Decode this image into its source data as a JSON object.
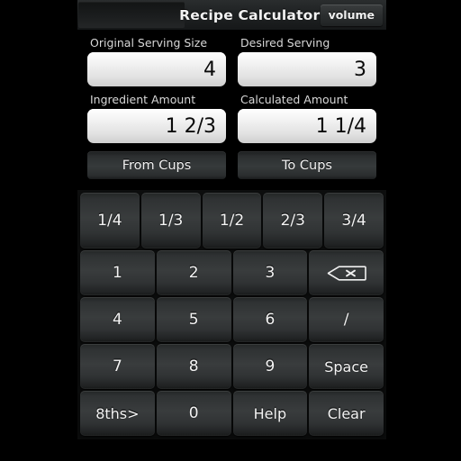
{
  "titlebar": {
    "title": "Recipe Calculator",
    "volume_label": "volume",
    "left_button_label": ""
  },
  "form": {
    "rows": [
      {
        "left": {
          "label": "Original Serving Size",
          "value": "4",
          "placeholder": ""
        },
        "right": {
          "label": "Desired Serving",
          "value": "3",
          "placeholder": ""
        }
      },
      {
        "left": {
          "label": "Ingredient Amount",
          "value": "1 2/3",
          "placeholder": ""
        },
        "right": {
          "label": "Calculated Amount",
          "value": "1 1/4",
          "placeholder": ""
        }
      }
    ],
    "from_cups_label": "From Cups",
    "to_cups_label": "To Cups"
  },
  "keypad": {
    "fraction_row": [
      "1/4",
      "1/3",
      "1/2",
      "2/3",
      "3/4"
    ],
    "rows": [
      [
        "1",
        "2",
        "3",
        "backspace-icon"
      ],
      [
        "4",
        "5",
        "6",
        "/"
      ],
      [
        "7",
        "8",
        "9",
        "Space"
      ],
      [
        "8ths>",
        "0",
        "Help",
        "Clear"
      ]
    ]
  },
  "colors": {
    "background": "#000000",
    "titlebar": "#202324",
    "key_face": "#393c3d",
    "input_face": "#f4f4f4",
    "text_light": "#f2f2f2",
    "text_dark": "#0a0a0a"
  }
}
